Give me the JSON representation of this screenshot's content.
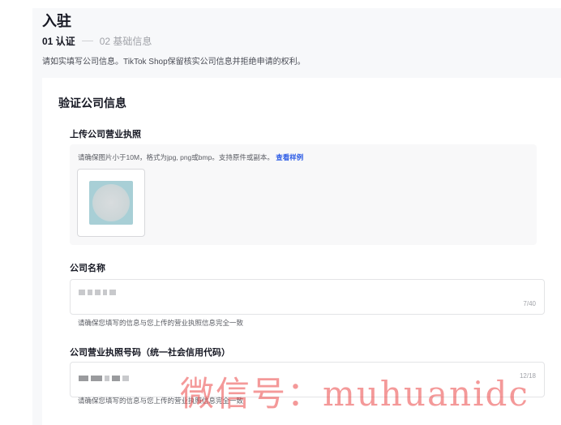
{
  "header": {
    "title": "入驻",
    "steps": [
      {
        "label": "01 认证",
        "active": true
      },
      {
        "label": "02 基础信息",
        "active": false
      }
    ],
    "intro": "请如实填写公司信息。TikTok Shop保留核实公司信息并拒绝申请的权利。"
  },
  "section": {
    "title": "验证公司信息"
  },
  "license_upload": {
    "label": "上传公司营业执照",
    "hint": "请确保图片小于10M，格式为jpg, png或bmp。支持原件或副本。",
    "sample_link": "查看样例"
  },
  "company_name": {
    "label": "公司名称",
    "counter": "7/40",
    "helper": "请确保您填写的信息与您上传的营业执照信息完全一致"
  },
  "license_number": {
    "label": "公司营业执照号码（统一社会信用代码）",
    "counter": "12/18",
    "helper": "请确保您填写的信息与您上传的营业执照信息完全一致"
  },
  "watermark": "微信号：muhuanidc",
  "colors": {
    "link": "#2d5ce6",
    "text_primary": "#161823",
    "text_secondary": "#5a5c63",
    "watermark": "#eb4646"
  }
}
